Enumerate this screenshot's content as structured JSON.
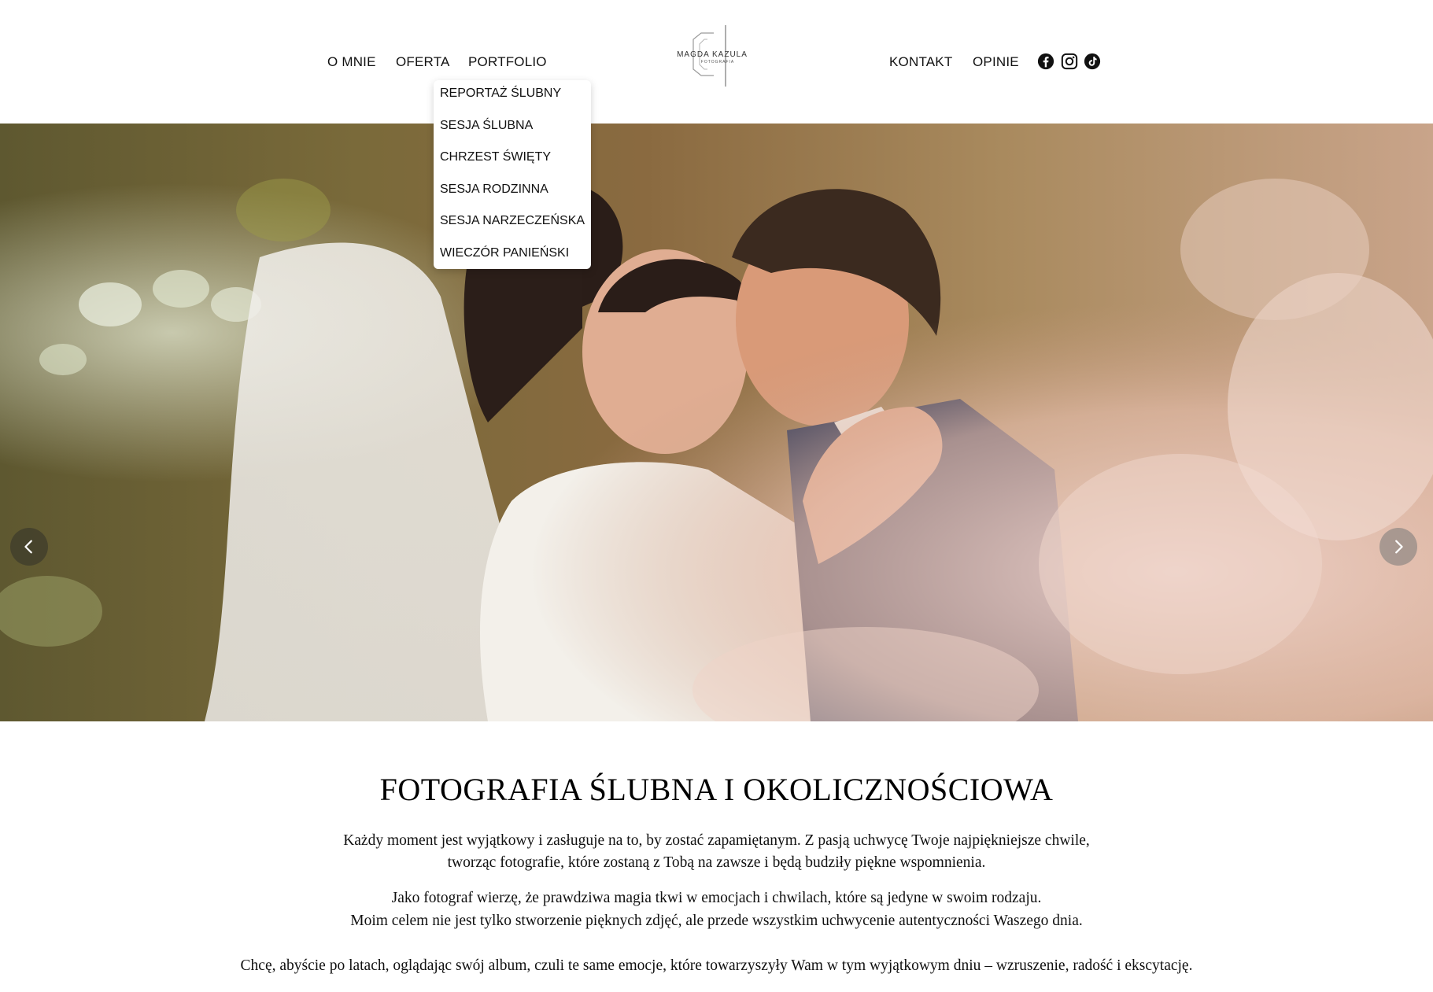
{
  "nav": {
    "left": [
      "O MNIE",
      "OFERTA",
      "PORTFOLIO"
    ],
    "right": [
      "KONTAKT",
      "OPINIE"
    ]
  },
  "logo": {
    "name": "MAGDA KAZULA",
    "tagline": "FOTOGRAFIA"
  },
  "social": {
    "icons": [
      "facebook-icon",
      "instagram-icon",
      "tiktok-icon"
    ]
  },
  "portfolio_menu": {
    "items": [
      "REPORTAŻ ŚLUBNY",
      "SESJA ŚLUBNA",
      "CHRZEST ŚWIĘTY",
      "SESJA RODZINNA",
      "SESJA NARZECZEŃSKA",
      "WIECZÓR PANIEŃSKI"
    ]
  },
  "hero": {
    "prev_icon": "chevron-left-icon",
    "next_icon": "chevron-right-icon"
  },
  "content": {
    "title": "FOTOGRAFIA ŚLUBNA I OKOLICZNOŚCIOWA",
    "lines": [
      "Każdy moment jest wyjątkowy i zasługuje na to, by zostać zapamiętanym. Z pasją uchwycę Twoje najpiękniejsze chwile,",
      "tworząc fotografie, które zostaną z Tobą na zawsze i będą budziły piękne wspomnienia.",
      "Jako fotograf wierzę, że prawdziwa magia tkwi w emocjach i chwilach, które są jedyne w swoim rodzaju.",
      "Moim celem nie jest tylko stworzenie pięknych zdjęć, ale przede wszystkim uchwycenie autentyczności Waszego dnia.",
      "Chcę, abyście po latach, oglądając swój album, czuli te same emocje, które towarzyszyły Wam w tym wyjątkowym dniu – wzruszenie, radość i ekscytację."
    ]
  }
}
